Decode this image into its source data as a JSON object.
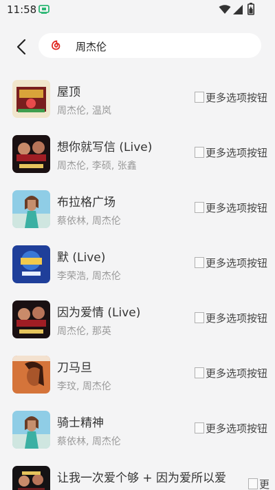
{
  "status_bar": {
    "time": "11:58",
    "icons": [
      "app-notification-icon",
      "wifi-icon",
      "signal-icon",
      "battery-icon"
    ]
  },
  "search": {
    "query": "周杰伦",
    "icon": "netease-music-icon"
  },
  "songs": [
    {
      "title": "屋顶",
      "artists": "周杰伦, 温岚",
      "more_label": "更多选项按钮"
    },
    {
      "title": "想你就写信 (Live)",
      "artists": "周杰伦, 李硕, 张鑫",
      "more_label": "更多选项按钮"
    },
    {
      "title": "布拉格广场",
      "artists": "蔡依林, 周杰伦",
      "more_label": "更多选项按钮"
    },
    {
      "title": "默 (Live)",
      "artists": "李荣浩, 周杰伦",
      "more_label": "更多选项按钮"
    },
    {
      "title": "因为爱情 (Live)",
      "artists": "周杰伦, 那英",
      "more_label": "更多选项按钮"
    },
    {
      "title": "刀马旦",
      "artists": "李玟, 周杰伦",
      "more_label": "更多选项按钮"
    },
    {
      "title": "骑士精神",
      "artists": "蔡依林, 周杰伦",
      "more_label": "更多选项按钮"
    },
    {
      "title": "让我一次爱个够 + 因为爱所以爱",
      "artists": "",
      "more_label": "更"
    }
  ],
  "colors": {
    "background": "#f4f4f5",
    "accent_red": "#e0261f",
    "title_text": "#333333",
    "artist_text": "#999999"
  }
}
